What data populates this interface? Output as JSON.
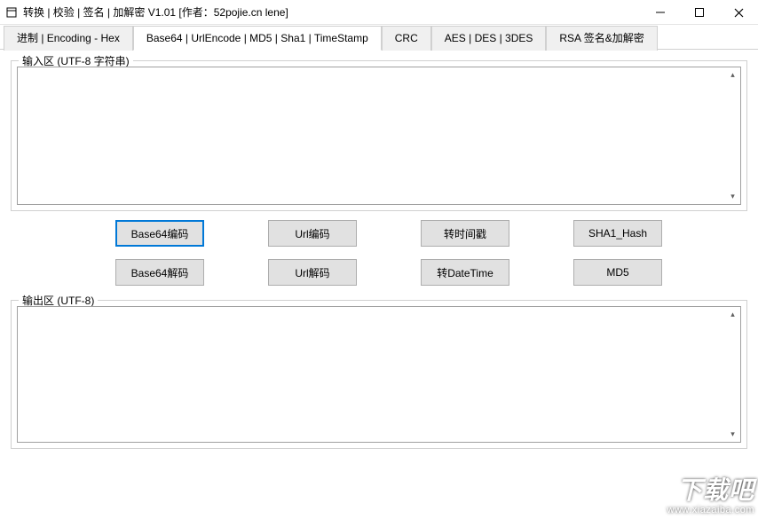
{
  "window": {
    "title": "转换 | 校验 | 签名 | 加解密 V1.01    [作者：52pojie.cn lene]"
  },
  "tabs": {
    "t0": "进制 | Encoding - Hex",
    "t1": "Base64 | UrlEncode | MD5 | Sha1 | TimeStamp",
    "t2": "CRC",
    "t3": "AES | DES | 3DES",
    "t4": "RSA 签名&加解密"
  },
  "input_section": {
    "label": "输入区 (UTF-8 字符串)",
    "value": ""
  },
  "output_section": {
    "label": "输出区 (UTF-8)",
    "value": ""
  },
  "buttons": {
    "base64_encode": "Base64编码",
    "url_encode": "Url编码",
    "to_timestamp": "转时间戳",
    "sha1_hash": "SHA1_Hash",
    "base64_decode": "Base64解码",
    "url_decode": "Url解码",
    "to_datetime": "转DateTime",
    "md5": "MD5"
  },
  "watermark": {
    "line1": "下载吧",
    "line2": "www.xiazaiba.com"
  }
}
